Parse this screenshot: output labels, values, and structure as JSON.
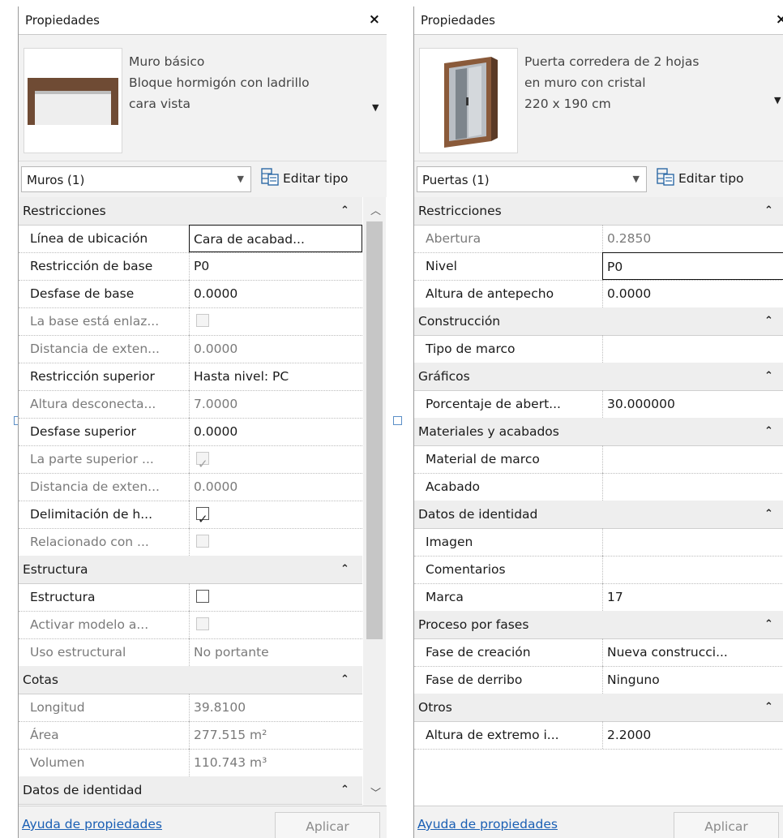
{
  "left": {
    "title": "Propiedades",
    "close": "×",
    "type_lines": [
      "Muro básico",
      "Bloque hormigón con ladrillo",
      "cara vista"
    ],
    "selector": "Muros (1)",
    "edit_type": "Editar tipo",
    "rows": [
      {
        "kind": "cat",
        "label": "Restricciones"
      },
      {
        "kind": "prop",
        "label": "Línea de ubicación",
        "value": "Cara de acabad...",
        "active": true
      },
      {
        "kind": "prop",
        "label": "Restricción de base",
        "value": "P0"
      },
      {
        "kind": "prop",
        "label": "Desfase de base",
        "value": "0.0000"
      },
      {
        "kind": "prop",
        "label": "La base está enlaz...",
        "check": "off",
        "disabled": true
      },
      {
        "kind": "prop",
        "label": "Distancia de exten...",
        "value": "0.0000",
        "disabled": true
      },
      {
        "kind": "prop",
        "label": "Restricción superior",
        "value": "Hasta nivel: PC"
      },
      {
        "kind": "prop",
        "label": "Altura desconecta...",
        "value": "7.0000",
        "disabled": true
      },
      {
        "kind": "prop",
        "label": "Desfase superior",
        "value": "0.0000"
      },
      {
        "kind": "prop",
        "label": "La parte superior ...",
        "check": "on",
        "disabled": true
      },
      {
        "kind": "prop",
        "label": "Distancia de exten...",
        "value": "0.0000",
        "disabled": true
      },
      {
        "kind": "prop",
        "label": "Delimitación de h...",
        "check": "on"
      },
      {
        "kind": "prop",
        "label": "Relacionado con ...",
        "check": "off",
        "disabled": true
      },
      {
        "kind": "cat",
        "label": "Estructura"
      },
      {
        "kind": "prop",
        "label": "Estructura",
        "check": "off"
      },
      {
        "kind": "prop",
        "label": "Activar modelo a...",
        "check": "off",
        "disabled": true
      },
      {
        "kind": "prop",
        "label": "Uso estructural",
        "value": "No portante",
        "disabled": true
      },
      {
        "kind": "cat",
        "label": "Cotas"
      },
      {
        "kind": "prop",
        "label": "Longitud",
        "value": "39.8100",
        "disabled": true
      },
      {
        "kind": "prop",
        "label": "Área",
        "value": "277.515 m²",
        "disabled": true
      },
      {
        "kind": "prop",
        "label": "Volumen",
        "value": "110.743 m³",
        "disabled": true
      },
      {
        "kind": "cat",
        "label": "Datos de identidad"
      }
    ],
    "help": "Ayuda de propiedades",
    "apply": "Aplicar"
  },
  "right": {
    "title": "Propiedades",
    "close": "×",
    "type_lines": [
      "Puerta corredera de 2 hojas",
      "en muro con cristal",
      "220 x 190 cm"
    ],
    "selector": "Puertas (1)",
    "edit_type": "Editar tipo",
    "rows": [
      {
        "kind": "cat",
        "label": "Restricciones"
      },
      {
        "kind": "prop",
        "label": "Abertura",
        "value": "0.2850",
        "disabled": true
      },
      {
        "kind": "prop",
        "label": "Nivel",
        "value": "P0",
        "active": true
      },
      {
        "kind": "prop",
        "label": "Altura de antepecho",
        "value": "0.0000"
      },
      {
        "kind": "cat",
        "label": "Construcción"
      },
      {
        "kind": "prop",
        "label": "Tipo de marco",
        "value": ""
      },
      {
        "kind": "cat",
        "label": "Gráficos"
      },
      {
        "kind": "prop",
        "label": "Porcentaje de abert...",
        "value": "30.000000"
      },
      {
        "kind": "cat",
        "label": "Materiales y acabados"
      },
      {
        "kind": "prop",
        "label": "Material de marco",
        "value": ""
      },
      {
        "kind": "prop",
        "label": "Acabado",
        "value": ""
      },
      {
        "kind": "cat",
        "label": "Datos de identidad"
      },
      {
        "kind": "prop",
        "label": "Imagen",
        "value": ""
      },
      {
        "kind": "prop",
        "label": "Comentarios",
        "value": ""
      },
      {
        "kind": "prop",
        "label": "Marca",
        "value": "17"
      },
      {
        "kind": "cat",
        "label": "Proceso por fases"
      },
      {
        "kind": "prop",
        "label": "Fase de creación",
        "value": "Nueva construcci..."
      },
      {
        "kind": "prop",
        "label": "Fase de derribo",
        "value": "Ninguno"
      },
      {
        "kind": "cat",
        "label": "Otros"
      },
      {
        "kind": "prop",
        "label": "Altura de extremo i...",
        "value": "2.2000"
      }
    ],
    "help": "Ayuda de propiedades",
    "apply": "Aplicar"
  },
  "icons": {
    "collapse": "collapse-up-icon",
    "dropdown": "chevron-down-icon",
    "edit_type": "edit-type-icon",
    "close": "close-icon"
  }
}
